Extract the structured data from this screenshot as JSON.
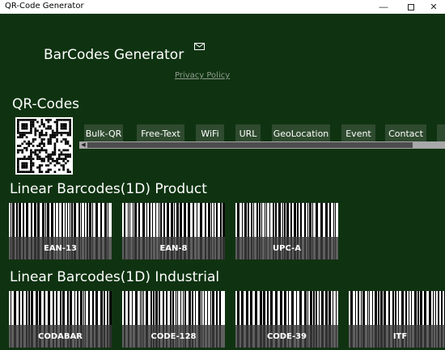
{
  "window": {
    "title": "QR-Code Generator"
  },
  "header": {
    "app_title": "BarCodes Generator",
    "privacy_link": "Privacy Policy"
  },
  "qr_section": {
    "title": "QR-Codes",
    "tabs": [
      "Bulk-QR",
      "Free-Text",
      "WiFi",
      "URL",
      "GeoLocation",
      "Event",
      "Contact"
    ]
  },
  "product_section": {
    "title": "Linear Barcodes(1D) Product",
    "items": [
      "EAN-13",
      "EAN-8",
      "UPC-A"
    ]
  },
  "industrial_section": {
    "title": "Linear Barcodes(1D) Industrial",
    "items": [
      "CODABAR",
      "CODE-128",
      "CODE-39",
      "ITF"
    ]
  },
  "icons": {
    "mail": "mail-icon",
    "minimize": "minimize-icon",
    "maximize": "maximize-icon",
    "close": "close-icon"
  },
  "colors": {
    "background": "#0f3311",
    "tab_bg": "#2f4b2f",
    "label_band": "#3c3c3c"
  }
}
